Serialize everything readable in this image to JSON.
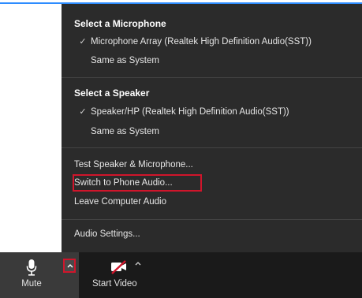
{
  "menu": {
    "microphone_header": "Select a Microphone",
    "microphone_items": [
      {
        "label": "Microphone Array (Realtek High Definition Audio(SST))",
        "checked": true
      },
      {
        "label": "Same as System",
        "checked": false
      }
    ],
    "speaker_header": "Select a Speaker",
    "speaker_items": [
      {
        "label": "Speaker/HP (Realtek High Definition Audio(SST))",
        "checked": true
      },
      {
        "label": "Same as System",
        "checked": false
      }
    ],
    "test_label": "Test Speaker & Microphone...",
    "switch_phone_label": "Switch to Phone Audio...",
    "leave_label": "Leave Computer Audio",
    "settings_label": "Audio Settings..."
  },
  "toolbar": {
    "mute_label": "Mute",
    "video_label": "Start Video"
  },
  "colors": {
    "menu_bg": "#2b2b2b",
    "toolbar_bg": "#1a1a1a",
    "highlight": "#d0152b",
    "video_off": "#d0152b",
    "accent": "#2d8cff"
  }
}
